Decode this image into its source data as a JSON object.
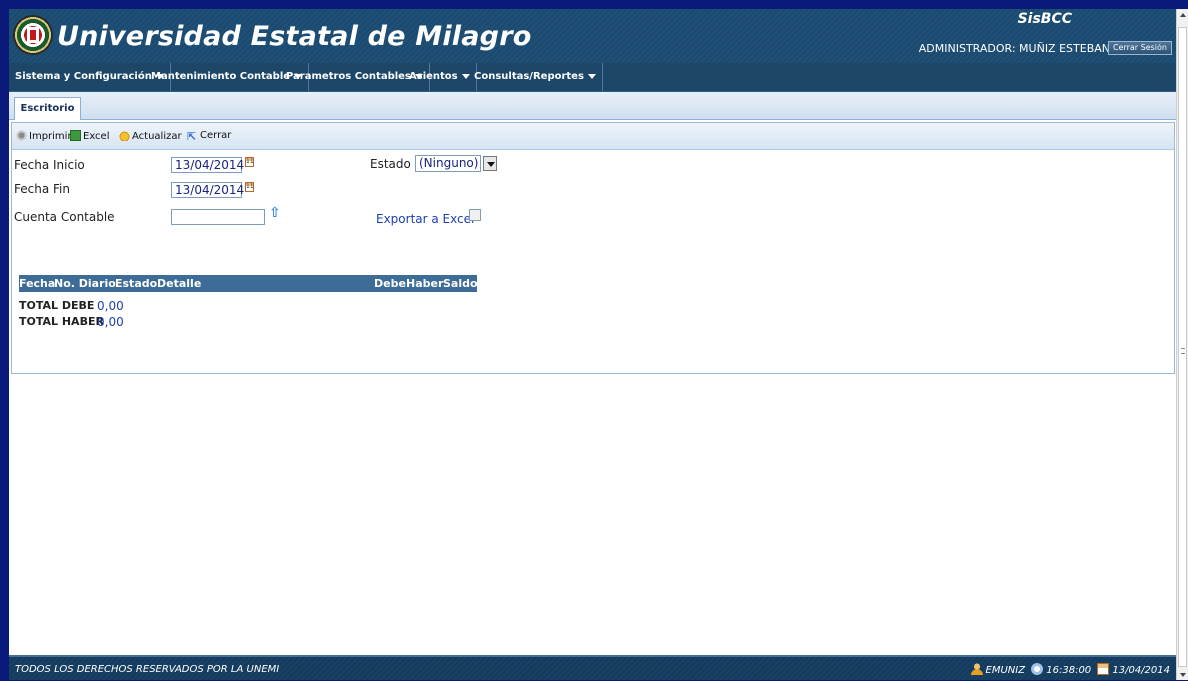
{
  "header": {
    "title": "Universidad Estatal de Milagro",
    "app_name": "SisBCC",
    "user_label": "ADMINISTRADOR: MUÑIZ ESTEBAN",
    "logout_label": "Cerrar Sesión"
  },
  "menu": {
    "items": [
      {
        "label": "Sistema y Configuración"
      },
      {
        "label": "Mantenimiento Contable"
      },
      {
        "label": "Parametros Contables"
      },
      {
        "label": "Asientos"
      },
      {
        "label": "Consultas/Reportes"
      }
    ]
  },
  "tabs": [
    {
      "label": "Escritorio",
      "active": true
    }
  ],
  "toolbar": {
    "print_label": "Imprimir",
    "excel_label": "Excel",
    "refresh_label": "Actualizar",
    "close_label": "Cerrar"
  },
  "form": {
    "fecha_inicio_label": "Fecha Inicio",
    "fecha_inicio_value": "13/04/2014",
    "fecha_fin_label": "Fecha Fin",
    "fecha_fin_value": "13/04/2014",
    "cuenta_label": "Cuenta Contable",
    "cuenta_value": "",
    "estado_label": "Estado",
    "estado_value": "(Ninguno)",
    "export_label": "Exportar a Excel",
    "export_checked": false
  },
  "grid": {
    "columns": [
      "Fecha",
      "No. Diario",
      "Estado",
      "Detalle",
      "Debe",
      "Haber",
      "Saldo"
    ],
    "rows": []
  },
  "totals": {
    "debe_label": "TOTAL DEBE",
    "debe_value": "0,00",
    "haber_label": "TOTAL HABER",
    "haber_value": "0,00"
  },
  "footer": {
    "copyright": "TODOS LOS DERECHOS RESERVADOS POR LA UNEMI",
    "username": "EMUNIZ",
    "time": "16:38:00",
    "date": "13/04/2014"
  },
  "colors": {
    "header_bg": "#1c4a6e",
    "menu_bg": "#1d4769",
    "grid_header_bg": "#3d6c97",
    "link": "#1d3fb3",
    "frame_border": "#0a1a7a"
  },
  "icons": {
    "print": "printer-icon",
    "excel": "excel-icon",
    "refresh": "refresh-icon",
    "close": "close-icon",
    "calendar": "calendar-icon",
    "lookup": "up-arrow-icon",
    "user": "user-icon",
    "clock": "clock-icon"
  }
}
